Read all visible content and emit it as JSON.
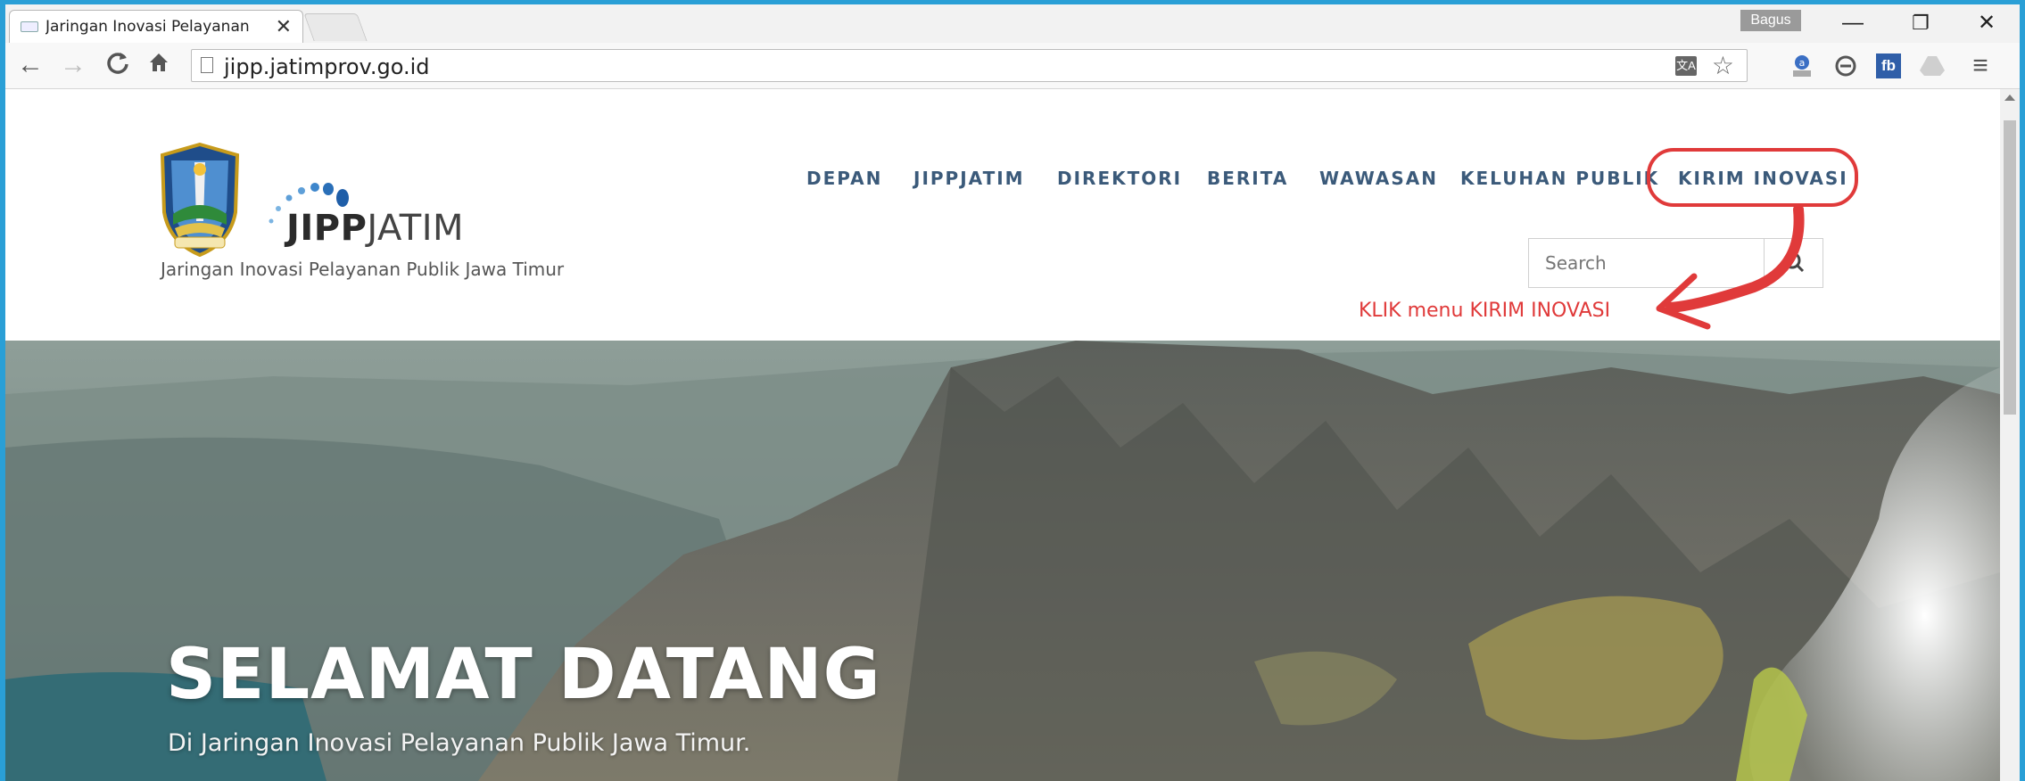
{
  "browser": {
    "tab_title": "Jaringan Inovasi Pelayanan",
    "tab_close": "✕",
    "profile": "Bagus",
    "minimize": "—",
    "restore": "❐",
    "close": "✕",
    "url": "jipp.jatimprov.go.id",
    "translate_icon_text": "文A",
    "extensions": [
      "adblock-icon",
      "sync-icon",
      "fb-icon",
      "drive-icon"
    ],
    "fb_label": "fb",
    "menu_icon": "≡"
  },
  "site": {
    "logo_bold": "JIPP",
    "logo_light": "JATIM",
    "tagline": "Jaringan Inovasi Pelayanan Publik Jawa Timur",
    "nav": [
      "DEPAN",
      "JIPPJATIM",
      "DIREKTORI",
      "BERITA",
      "WAWASAN",
      "KELUHAN PUBLIK",
      "KIRIM INOVASI"
    ],
    "search_placeholder": "Search"
  },
  "annotation": {
    "text": "KLIK menu KIRIM INOVASI",
    "color": "#e03a3a"
  },
  "hero": {
    "title": "SELAMAT DATANG",
    "subtitle": "Di Jaringan Inovasi Pelayanan Publik Jawa Timur."
  },
  "colors": {
    "nav_text": "#3b5a7a",
    "frame": "#2a9fd6"
  }
}
